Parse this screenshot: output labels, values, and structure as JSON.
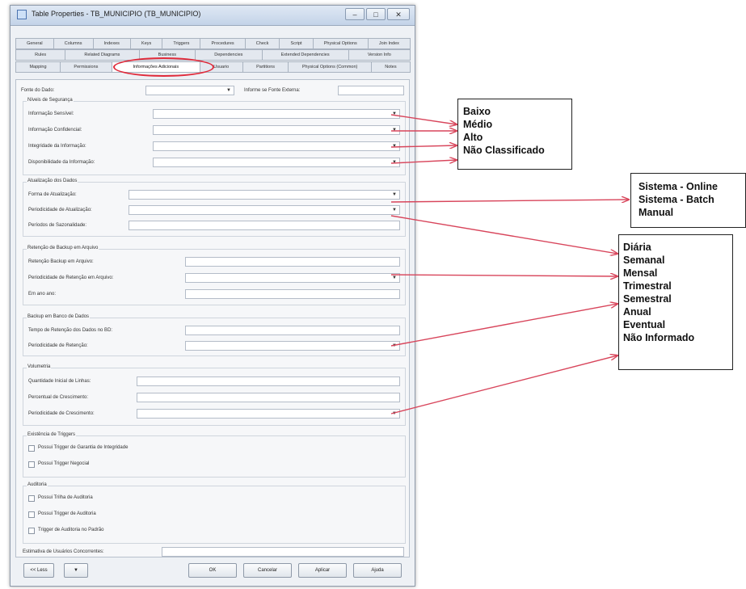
{
  "window": {
    "title": "Table Properties - TB_MUNICIPIO (TB_MUNICIPIO)",
    "min_label": "–",
    "max_label": "□",
    "close_label": "✕"
  },
  "tabs": {
    "row1": [
      "General",
      "Columns",
      "Indexes",
      "Keys",
      "Triggers",
      "Procedures",
      "Check",
      "Script",
      "Physical Options",
      "Join Index"
    ],
    "row2": [
      "Rules",
      "Related Diagrams",
      "Business",
      "Dependencies",
      "Extended Dependencies",
      "Version Info"
    ],
    "row3": [
      "Mapping",
      "Permissions",
      "Informações Adicionais",
      "Usuario",
      "Partitions",
      "Physical Options (Common)",
      "Notes"
    ],
    "active": "Informações Adicionais"
  },
  "form": {
    "fonte_label": "Fonte do Dado:",
    "fonte_externa_label": "Informe se Fonte Externa:",
    "groups": {
      "sigilo": {
        "title": "Níveis de Segurança",
        "fields": [
          "Informação Sensível:",
          "Informação Confidencial:",
          "Integridade da Informação:",
          "Disponibilidade da Informação:"
        ]
      },
      "atualizacao": {
        "title": "Atualização dos Dados",
        "fields": [
          "Forma de Atualização:",
          "Periodicidade de Atualização:",
          "Períodos de Sazonalidade:"
        ]
      },
      "retencao": {
        "title": "Retenção de Backup em Arquivo",
        "fields": [
          "Retenção Backup em Arquivo:",
          "Periodicidade de Retenção em Arquivo:",
          "Em ano ano:"
        ]
      },
      "backup": {
        "title": "Backup em Banco de Dados",
        "fields": [
          "Tempo de Retenção dos Dados no BD:",
          "Periodicidade de Retenção:"
        ]
      },
      "volumetria": {
        "title": "Volumetria",
        "fields": [
          "Quantidade Inicial de Linhas:",
          "Percentual de Crescimento:",
          "Periodicidade de Crescimento:"
        ]
      },
      "triggers": {
        "title": "Existência de Triggers",
        "checks": [
          "Possui Trigger de Garantia de Integridade",
          "Possui Trigger Negocial"
        ]
      },
      "auditoria": {
        "title": "Auditoria",
        "checks": [
          "Possui Trilha de Auditoria",
          "Possui Trigger de Auditoria",
          "Trigger de Auditoria no Padrão"
        ]
      }
    },
    "usuarios_label": "Estimativa de Usuários Concorrentes:"
  },
  "buttons": {
    "less": "<< Less",
    "menu": "▼",
    "ok": "OK",
    "cancel": "Cancelar",
    "apply": "Aplicar",
    "help": "Ajuda"
  },
  "callouts": {
    "security": [
      "Baixo",
      "Médio",
      "Alto",
      "Não Classificado"
    ],
    "update_form": [
      "Sistema - Online",
      "Sistema - Batch",
      "Manual"
    ],
    "periodicity": [
      "Diária",
      "Semanal",
      "Mensal",
      "Trimestral",
      "Semestral",
      "Anual",
      "Eventual",
      "Não Informado"
    ]
  },
  "colors": {
    "arrow": "#d8455b",
    "highlight": "#e02a3a"
  }
}
